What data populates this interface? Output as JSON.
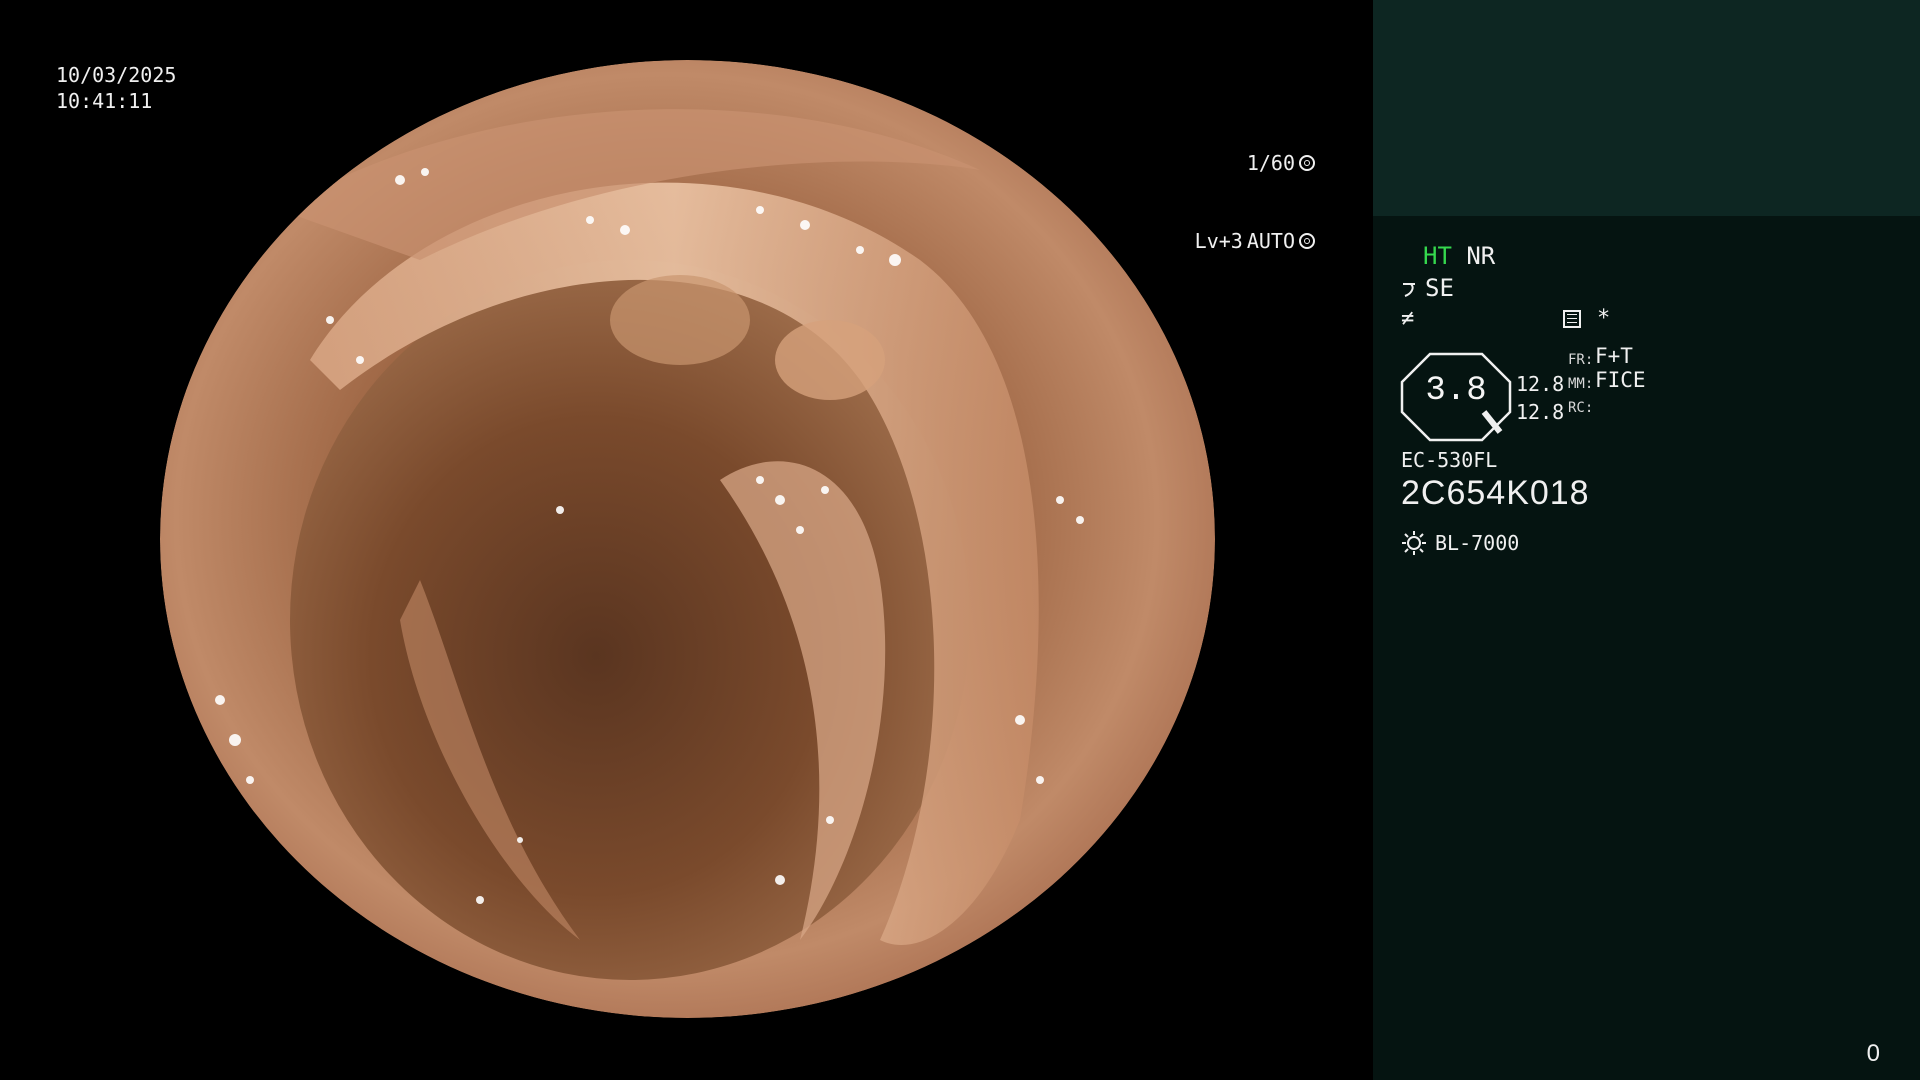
{
  "osd": {
    "date": "10/03/2025",
    "time": "10:41:11",
    "shutter": "1/60",
    "level": "Lv+3",
    "mode": "AUTO"
  },
  "panel": {
    "ht": "HT",
    "nr": "NR",
    "se": "SE",
    "fx_symbol": "≠",
    "star": "*",
    "zoom": "3.8",
    "val_1": "12.8",
    "val_2": "12.8",
    "label_fr": "FR:",
    "label_mm": "MM:",
    "label_rc": "RC:",
    "mode_fr": "F+T",
    "mode_mm": "FICE",
    "mode_rc": "",
    "scope_model": "EC-530FL",
    "serial": "2C654K018",
    "light_source": "BL-7000",
    "counter": "0"
  },
  "icons": {
    "shutter": "shutter-icon",
    "auto": "auto-iris-icon",
    "se": "hook-icon",
    "fx": "fx-icon",
    "menu": "list-icon",
    "light": "sun-icon"
  },
  "colors": {
    "ht_green": "#35d84e",
    "panel_bg": "#051411",
    "panel_top_bg": "#0d2622"
  }
}
